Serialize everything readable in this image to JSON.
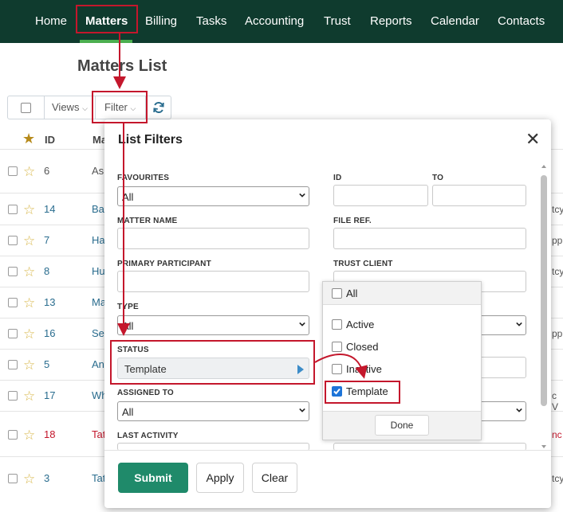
{
  "nav": {
    "items": [
      "Home",
      "Matters",
      "Billing",
      "Tasks",
      "Accounting",
      "Trust",
      "Reports",
      "Calendar",
      "Contacts"
    ],
    "active": "Matters"
  },
  "page_title": "Matters List",
  "toolbar": {
    "views_label": "Views",
    "filter_label": "Filter"
  },
  "list": {
    "header_id": "ID",
    "header_matter": "Ma",
    "rows": [
      {
        "id": "6",
        "matter": "Ash",
        "tail": ""
      },
      {
        "id": "14",
        "matter": "Ba",
        "tail": "tcy"
      },
      {
        "id": "7",
        "matter": "Ha",
        "tail": "pp"
      },
      {
        "id": "8",
        "matter": "Hu",
        "tail": "tcy"
      },
      {
        "id": "13",
        "matter": "Ma",
        "tail": ""
      },
      {
        "id": "16",
        "matter": "Ser",
        "tail": "pp"
      },
      {
        "id": "5",
        "matter": "An",
        "tail": ""
      },
      {
        "id": "17",
        "matter": "Wh",
        "tail": "c V"
      },
      {
        "id": "18",
        "matter": "Tat",
        "tail": "nc"
      },
      {
        "id": "3",
        "matter": "Tat",
        "tail": "tcy"
      }
    ]
  },
  "modal": {
    "title": "List Filters",
    "favourites_label": "FAVOURITES",
    "favourites_value": "All",
    "id_label": "ID",
    "to_label": "TO",
    "matter_name_label": "MATTER NAME",
    "file_ref_label": "FILE REF.",
    "primary_participant_label": "PRIMARY PARTICIPANT",
    "trust_client_label": "TRUST CLIENT",
    "type_label": "TYPE",
    "type_value": "All",
    "status_label": "STATUS",
    "status_value": "Template",
    "assigned_to_label": "ASSIGNED TO",
    "assigned_to_value": "All",
    "last_activity_label": "LAST ACTIVITY",
    "submit_label": "Submit",
    "apply_label": "Apply",
    "clear_label": "Clear"
  },
  "status_dropdown": {
    "all_label": "All",
    "options": [
      {
        "label": "Active",
        "checked": false
      },
      {
        "label": "Closed",
        "checked": false
      },
      {
        "label": "Inactive",
        "checked": false
      },
      {
        "label": "Template",
        "checked": true
      }
    ],
    "done_label": "Done"
  },
  "colors": {
    "nav_bg": "#0f3b2e",
    "submit_bg": "#1f8a6a",
    "annotation": "#c4172c",
    "checkbox_checked": "#1d74d8"
  }
}
